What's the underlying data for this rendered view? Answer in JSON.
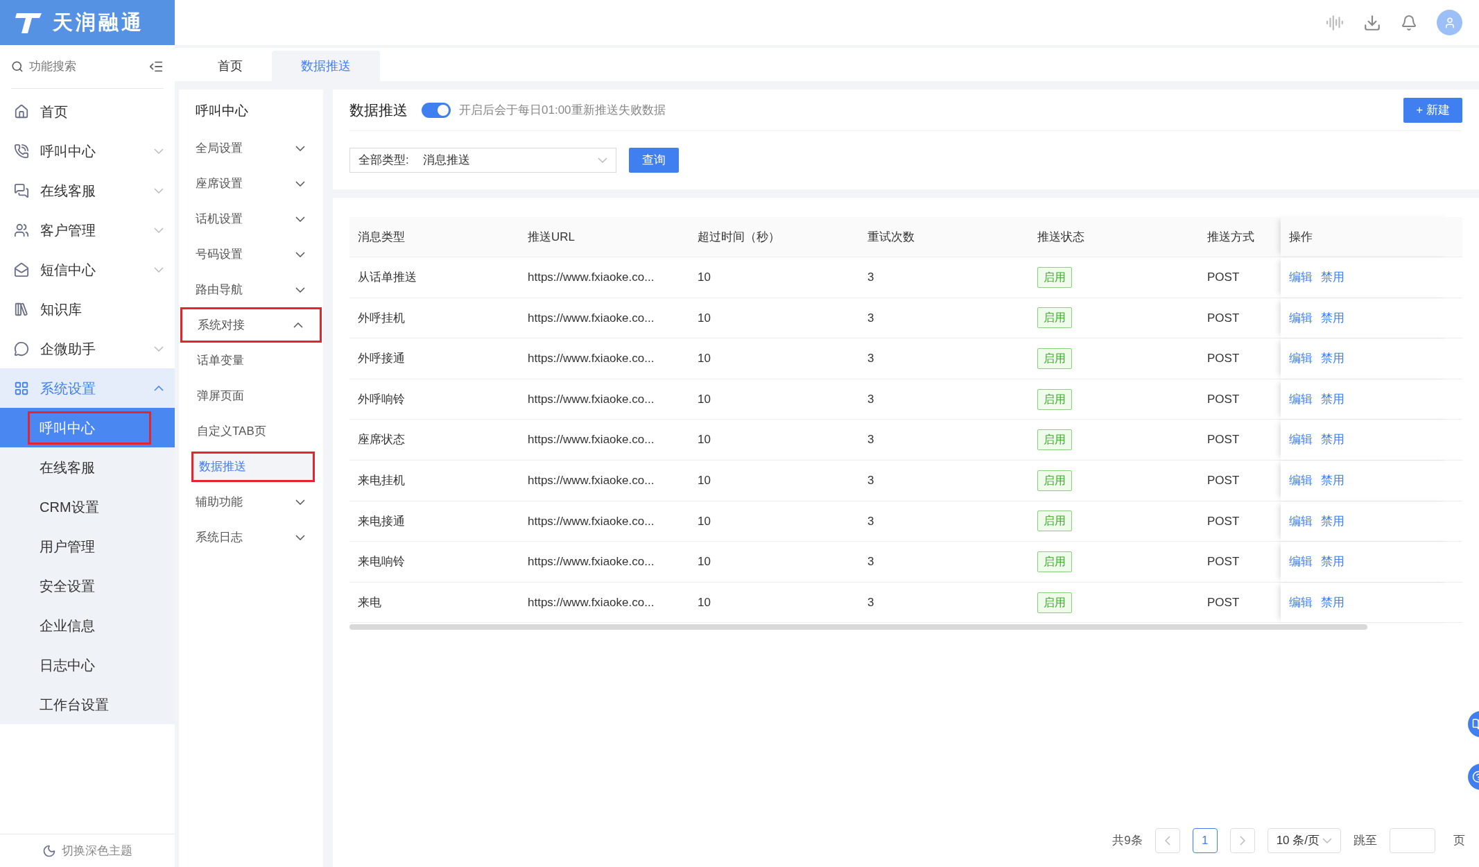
{
  "logo": {
    "text": "天润融通"
  },
  "sidebar": {
    "search_placeholder": "功能搜索",
    "items": [
      {
        "label": "首页",
        "kind": "link",
        "selected": false
      },
      {
        "label": "呼叫中心",
        "kind": "group",
        "expanded": false,
        "selected": false
      },
      {
        "label": "在线客服",
        "kind": "group",
        "expanded": false,
        "selected": false
      },
      {
        "label": "客户管理",
        "kind": "group",
        "expanded": false,
        "selected": false
      },
      {
        "label": "短信中心",
        "kind": "group",
        "expanded": false,
        "selected": false
      },
      {
        "label": "知识库",
        "kind": "link",
        "selected": false
      },
      {
        "label": "企微助手",
        "kind": "group",
        "expanded": false,
        "selected": false
      },
      {
        "label": "系统设置",
        "kind": "group",
        "expanded": true,
        "selected": true,
        "children": [
          {
            "label": "呼叫中心",
            "selected": true,
            "annotated": true
          },
          {
            "label": "在线客服",
            "selected": false,
            "annotated": false
          },
          {
            "label": "CRM设置",
            "selected": false,
            "annotated": false
          },
          {
            "label": "用户管理",
            "selected": false,
            "annotated": false
          },
          {
            "label": "安全设置",
            "selected": false,
            "annotated": false
          },
          {
            "label": "企业信息",
            "selected": false,
            "annotated": false
          },
          {
            "label": "日志中心",
            "selected": false,
            "annotated": false
          },
          {
            "label": "工作台设置",
            "selected": false,
            "annotated": false
          }
        ]
      }
    ],
    "footer": "切换深色主题"
  },
  "tabs": [
    {
      "label": "首页",
      "selected": false
    },
    {
      "label": "数据推送",
      "selected": true
    }
  ],
  "submenu": {
    "title": "呼叫中心",
    "items": [
      {
        "label": "全局设置",
        "expanded": false,
        "annotated": false
      },
      {
        "label": "座席设置",
        "expanded": false,
        "annotated": false
      },
      {
        "label": "话机设置",
        "expanded": false,
        "annotated": false
      },
      {
        "label": "号码设置",
        "expanded": false,
        "annotated": false
      },
      {
        "label": "路由导航",
        "expanded": false,
        "annotated": false
      },
      {
        "label": "系统对接",
        "expanded": true,
        "annotated": true,
        "children": [
          {
            "label": "话单变量",
            "selected": false,
            "annotated": false
          },
          {
            "label": "弹屏页面",
            "selected": false,
            "annotated": false
          },
          {
            "label": "自定义TAB页",
            "selected": false,
            "annotated": false
          },
          {
            "label": "数据推送",
            "selected": true,
            "annotated": true
          }
        ]
      },
      {
        "label": "辅助功能",
        "expanded": false,
        "annotated": false
      },
      {
        "label": "系统日志",
        "expanded": false,
        "annotated": false
      }
    ]
  },
  "main": {
    "title": "数据推送",
    "toggle": {
      "on": true
    },
    "hint": "开启后会于每日01:00重新推送失败数据",
    "new_button": "+ 新建",
    "filter": {
      "label": "全部类型:",
      "value": "消息推送"
    },
    "query_button": "查询"
  },
  "table": {
    "columns": [
      "消息类型",
      "推送URL",
      "超过时间（秒）",
      "重试次数",
      "推送状态",
      "推送方式",
      "操作"
    ],
    "rows": [
      {
        "type": "从话单推送",
        "url": "https://www.fxiaoke.co...",
        "timeout": "10",
        "retries": "3",
        "status": "启用",
        "method": "POST",
        "actions": [
          "编辑",
          "禁用"
        ]
      },
      {
        "type": "外呼挂机",
        "url": "https://www.fxiaoke.co...",
        "timeout": "10",
        "retries": "3",
        "status": "启用",
        "method": "POST",
        "actions": [
          "编辑",
          "禁用"
        ]
      },
      {
        "type": "外呼接通",
        "url": "https://www.fxiaoke.co...",
        "timeout": "10",
        "retries": "3",
        "status": "启用",
        "method": "POST",
        "actions": [
          "编辑",
          "禁用"
        ]
      },
      {
        "type": "外呼响铃",
        "url": "https://www.fxiaoke.co...",
        "timeout": "10",
        "retries": "3",
        "status": "启用",
        "method": "POST",
        "actions": [
          "编辑",
          "禁用"
        ]
      },
      {
        "type": "座席状态",
        "url": "https://www.fxiaoke.co...",
        "timeout": "10",
        "retries": "3",
        "status": "启用",
        "method": "POST",
        "actions": [
          "编辑",
          "禁用"
        ]
      },
      {
        "type": "来电挂机",
        "url": "https://www.fxiaoke.co...",
        "timeout": "10",
        "retries": "3",
        "status": "启用",
        "method": "POST",
        "actions": [
          "编辑",
          "禁用"
        ]
      },
      {
        "type": "来电接通",
        "url": "https://www.fxiaoke.co...",
        "timeout": "10",
        "retries": "3",
        "status": "启用",
        "method": "POST",
        "actions": [
          "编辑",
          "禁用"
        ]
      },
      {
        "type": "来电响铃",
        "url": "https://www.fxiaoke.co...",
        "timeout": "10",
        "retries": "3",
        "status": "启用",
        "method": "POST",
        "actions": [
          "编辑",
          "禁用"
        ]
      },
      {
        "type": "来电",
        "url": "https://www.fxiaoke.co...",
        "timeout": "10",
        "retries": "3",
        "status": "启用",
        "method": "POST",
        "actions": [
          "编辑",
          "禁用"
        ]
      }
    ]
  },
  "pagination": {
    "total": "共9条",
    "pages": [
      {
        "label": "1",
        "selected": true
      }
    ],
    "page_size": "10 条/页",
    "jump_label": "跳至",
    "page_suffix": "页"
  }
}
